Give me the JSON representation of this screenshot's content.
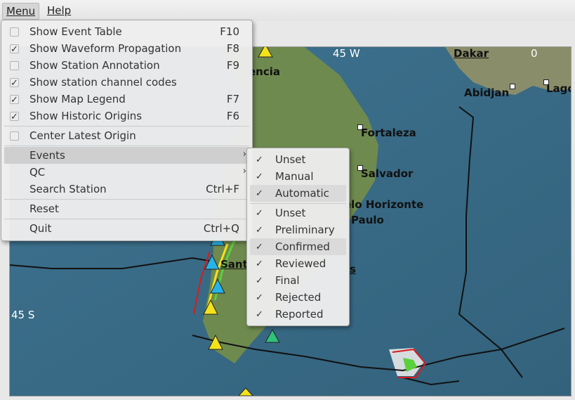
{
  "menubar": {
    "menu": "Menu",
    "help": "Help"
  },
  "main_menu": {
    "items": [
      {
        "label": "Show Event Table",
        "shortcut": "F10",
        "checked": false
      },
      {
        "label": "Show Waveform Propagation",
        "shortcut": "F8",
        "checked": true
      },
      {
        "label": "Show Station Annotation",
        "shortcut": "F9",
        "checked": false
      },
      {
        "label": "Show station channel codes",
        "shortcut": "",
        "checked": true
      },
      {
        "label": "Show Map Legend",
        "shortcut": "F7",
        "checked": true
      },
      {
        "label": "Show Historic Origins",
        "shortcut": "F6",
        "checked": true
      }
    ],
    "center_latest": "Center Latest Origin",
    "events": "Events",
    "qc": "QC",
    "search_station": "Search Station",
    "search_shortcut": "Ctrl+F",
    "reset": "Reset",
    "quit": "Quit",
    "quit_shortcut": "Ctrl+Q"
  },
  "events_submenu": {
    "group1": [
      {
        "label": "Unset",
        "checked": true
      },
      {
        "label": "Manual",
        "checked": true
      },
      {
        "label": "Automatic",
        "checked": true
      }
    ],
    "group2": [
      {
        "label": "Unset",
        "checked": true
      },
      {
        "label": "Preliminary",
        "checked": true
      },
      {
        "label": "Confirmed",
        "checked": true
      },
      {
        "label": "Reviewed",
        "checked": true
      },
      {
        "label": "Final",
        "checked": true
      },
      {
        "label": "Rejected",
        "checked": true
      },
      {
        "label": "Reported",
        "checked": true
      }
    ]
  },
  "map": {
    "grid_lon": "45 W",
    "grid_lon_zero": "0",
    "grid_lat": "45 S",
    "cities": {
      "dakar": "Dakar",
      "abidjan": "Abidjan",
      "lagos": "Lago",
      "fortaleza": "Fortaleza",
      "salvador": "Salvador",
      "belo": "elo Horizonte",
      "paulo": "Paulo",
      "valencia": "encia",
      "santiago": "Sant",
      "s": "s"
    }
  },
  "colors": {
    "ocean": "#3a6a86",
    "land": "#7b8a62",
    "station_yellow": "#f4e21a",
    "station_cyan": "#27b3e8",
    "station_green": "#2ec27a",
    "wave_red": "#d81c1c"
  }
}
